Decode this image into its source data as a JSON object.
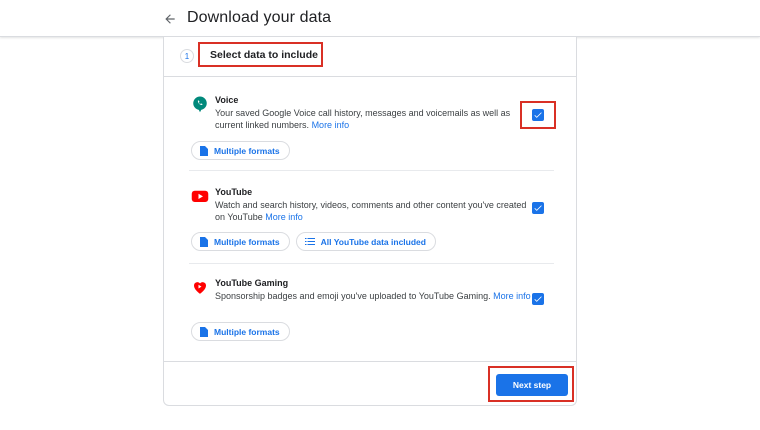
{
  "header": {
    "title": "Download your data",
    "back_icon": "arrow-back-icon"
  },
  "step": {
    "number": "1",
    "title": "Select data to include"
  },
  "products": [
    {
      "name": "Voice",
      "description": "Your saved Google Voice call history, messages and voicemails as well as current linked numbers.",
      "more_label": "More info",
      "checked": true,
      "chips": [
        {
          "icon": "file-icon",
          "label": "Multiple formats"
        }
      ]
    },
    {
      "name": "YouTube",
      "description": "Watch and search history, videos, comments and other content you've created on YouTube",
      "more_label": "More info",
      "checked": true,
      "chips": [
        {
          "icon": "file-icon",
          "label": "Multiple formats"
        },
        {
          "icon": "list-icon",
          "label": "All YouTube data included"
        }
      ]
    },
    {
      "name": "YouTube Gaming",
      "description": "Sponsorship badges and emoji you've uploaded to YouTube Gaming.",
      "more_label": "More info",
      "checked": true,
      "chips": [
        {
          "icon": "file-icon",
          "label": "Multiple formats"
        }
      ]
    }
  ],
  "footer": {
    "next_label": "Next step"
  },
  "colors": {
    "accent": "#1a73e8",
    "highlight": "#d93025",
    "voice": "#00897b",
    "youtube": "#ff0000"
  }
}
